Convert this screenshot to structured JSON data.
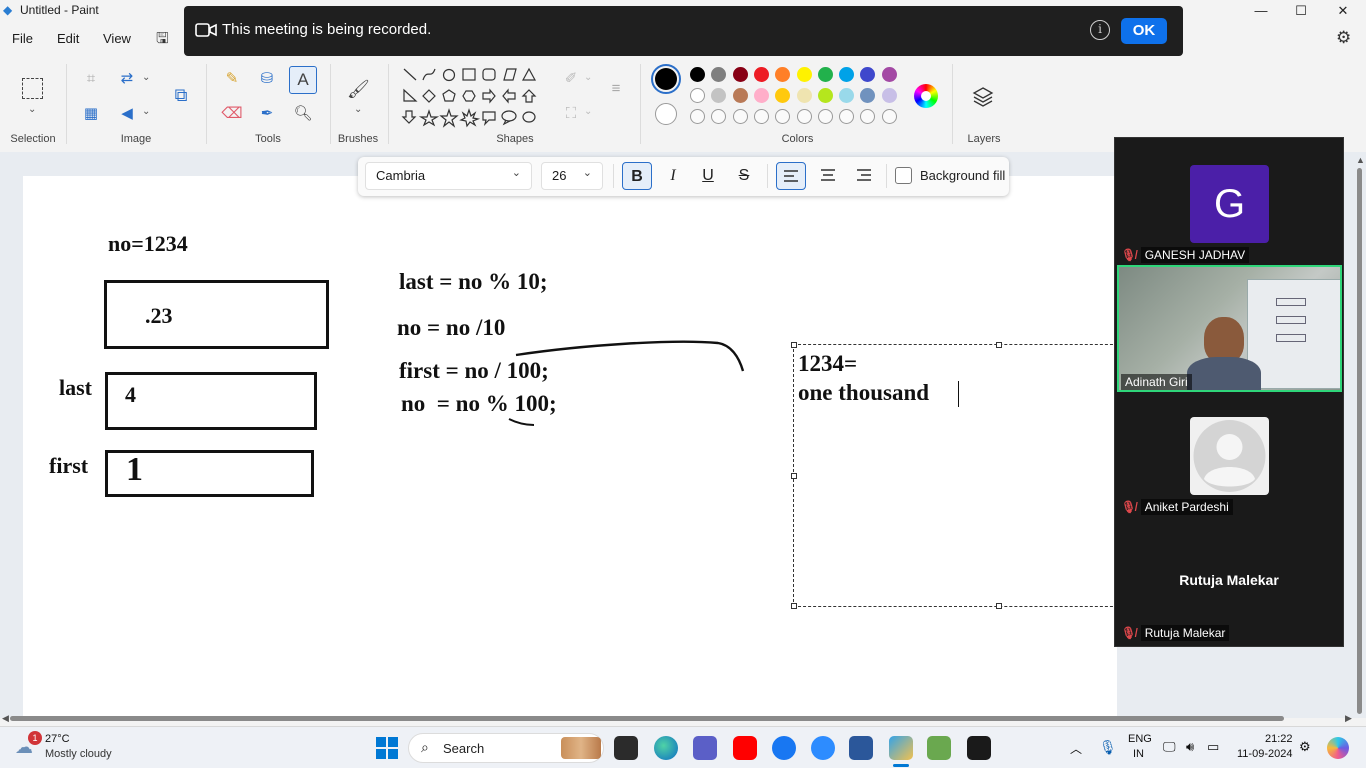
{
  "app": {
    "title": "Untitled - Paint",
    "window_controls": {
      "minimize": "—",
      "maximize": "☐",
      "close": "✕"
    }
  },
  "menu": {
    "file": "File",
    "edit": "Edit",
    "view": "View"
  },
  "banner": {
    "text": "This meeting is being recorded.",
    "ok_label": "OK",
    "info_glyph": "i"
  },
  "ribbon": {
    "groups": {
      "selection": "Selection",
      "image": "Image",
      "tools": "Tools",
      "brushes": "Brushes",
      "shapes": "Shapes",
      "colors": "Colors",
      "layers": "Layers"
    },
    "tools_icons": [
      "pencil-icon",
      "fill-icon",
      "text-icon",
      "eraser-icon",
      "color-picker-icon",
      "magnifier-icon"
    ],
    "shape_glyphs": [
      "╲",
      "∿",
      "◯",
      "▭",
      "▢",
      "⏢",
      "△",
      "◺",
      "◇",
      "⬠",
      "⬡",
      "⇨",
      "⇦",
      "⇧",
      "⇩",
      "✧",
      "☆",
      "✲",
      "💬",
      "◯",
      "◌"
    ],
    "color_rows": [
      [
        "#000000",
        "#7f7f7f",
        "#880015",
        "#ed1c24",
        "#ff7f27",
        "#fff200",
        "#22b14c",
        "#00a2e8",
        "#3f48cc",
        "#a349a4"
      ],
      [
        "#ffffff",
        "#c3c3c3",
        "#b97a57",
        "#ffaec9",
        "#ffc90e",
        "#efe4b0",
        "#b5e61d",
        "#99d9ea",
        "#7092be",
        "#c8bfe7"
      ],
      [
        "",
        "",
        "",
        "",
        "",
        "",
        "",
        "",
        "",
        ""
      ]
    ],
    "primary_color": "#000000",
    "secondary_color": "#ffffff"
  },
  "text_toolbar": {
    "font": "Cambria",
    "size": "26",
    "bold": "B",
    "italic": "I",
    "underline": "U",
    "strike": "S",
    "background_fill": "Background fill"
  },
  "canvas": {
    "no_label": "no=1234",
    "box1_value": ".23",
    "last_label": "last",
    "box2_value": "4",
    "first_label": "first",
    "box3_value": "1",
    "code_line1": "last = no % 10;",
    "code_line2": "no = no /10",
    "code_line3": "first = no / 100;",
    "code_line4": "no  = no % 100;",
    "text_line1": "1234=",
    "text_line2": "one thousand"
  },
  "meeting": {
    "participants": [
      {
        "name": "GANESH JADHAV",
        "initial": "G",
        "avatar_color": "#4b1fa8",
        "muted": true
      },
      {
        "name": "Adinath Giri",
        "video": true,
        "active": true,
        "muted": false
      },
      {
        "name": "Aniket Pardeshi",
        "muted": true
      },
      {
        "name": "Rutuja Malekar",
        "display": "Rutuja Malekar",
        "muted": true
      }
    ]
  },
  "taskbar": {
    "weather_temp": "27°C",
    "weather_desc": "Mostly cloudy",
    "weather_badge": "1",
    "search_label": "Search",
    "lang_top": "ENG",
    "lang_bottom": "IN",
    "time": "21:22",
    "date": "11-09-2024"
  }
}
